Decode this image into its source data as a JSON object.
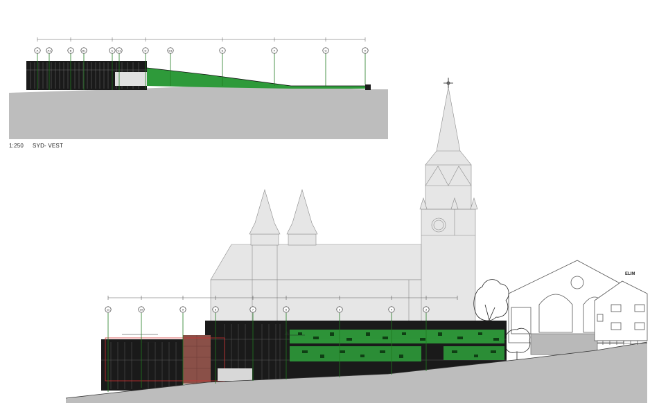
{
  "drawing": {
    "scale": "1:250",
    "view_title": "SYD- VEST",
    "neighbor_label": "ELIM"
  },
  "elevation_top": {
    "grid_labels": [
      "A",
      "A1",
      "B",
      "B1",
      "C",
      "C1",
      "D",
      "D1",
      "E",
      "F",
      "G",
      "H"
    ]
  },
  "elevation_bottom": {
    "grid_labels": [
      "11",
      "10",
      "9",
      "8",
      "7",
      "6",
      "5",
      "4",
      "3"
    ]
  },
  "colors": {
    "ground": "#bdbdbd",
    "facade": "#1a1a1a",
    "green_roof": "#2e9a3a",
    "gridline": "#1f7a1f",
    "church": "#e6e6e6",
    "brick_panel": "#8a5048",
    "outline_red": "#d13030"
  }
}
